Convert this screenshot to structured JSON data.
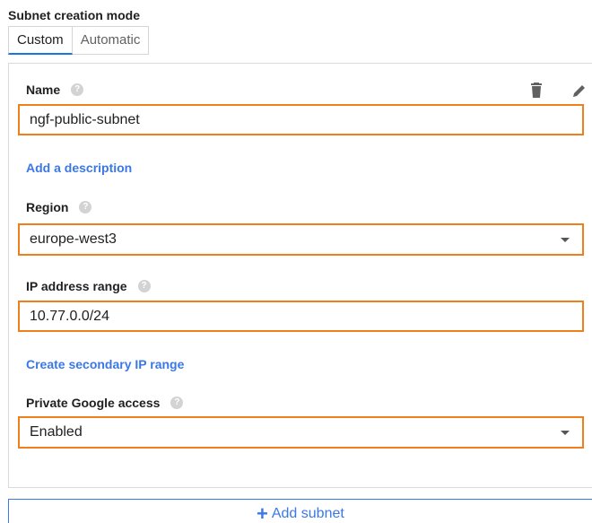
{
  "subnet_mode": {
    "label": "Subnet creation mode",
    "options": [
      "Custom",
      "Automatic"
    ],
    "selected": "Custom"
  },
  "subnet": {
    "name_label": "Name",
    "name_value": "ngf-public-subnet",
    "add_description_link": "Add a description",
    "region_label": "Region",
    "region_value": "europe-west3",
    "ip_range_label": "IP address range",
    "ip_range_value": "10.77.0.0/24",
    "secondary_range_link": "Create secondary IP range",
    "private_access_label": "Private Google access",
    "private_access_value": "Enabled",
    "help_glyph": "?"
  },
  "actions": {
    "add_subnet_label": "Add subnet",
    "add_subnet_icon": "+"
  },
  "icons": [
    "help-icon",
    "delete-icon",
    "edit-icon",
    "dropdown-caret-icon",
    "plus-icon"
  ],
  "colors": {
    "highlight": "#ef7f1a",
    "link": "#3b78e7",
    "active_tab_underline": "#1a73e8"
  }
}
